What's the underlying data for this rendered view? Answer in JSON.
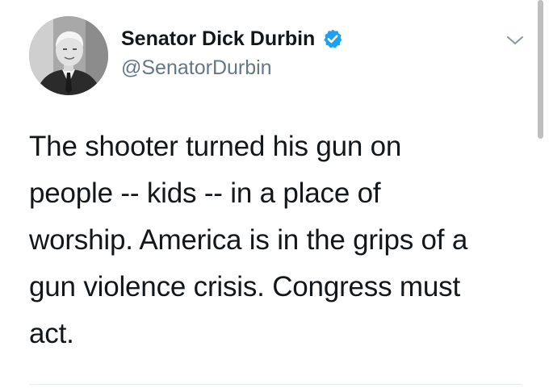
{
  "author": {
    "display_name": "Senator Dick Durbin",
    "handle": "@SenatorDurbin",
    "verified": true
  },
  "tweet": {
    "lines": [
      "The shooter turned his gun on",
      "people -- kids -- in a place of",
      "worship. America is in the grips of a",
      "gun violence crisis. Congress must",
      "act."
    ]
  },
  "icons": {
    "verified": "verified-badge-icon",
    "menu": "chevron-down-icon"
  },
  "colors": {
    "verified_blue": "#1da1f2",
    "handle_gray": "#657786",
    "text": "#14171a"
  }
}
